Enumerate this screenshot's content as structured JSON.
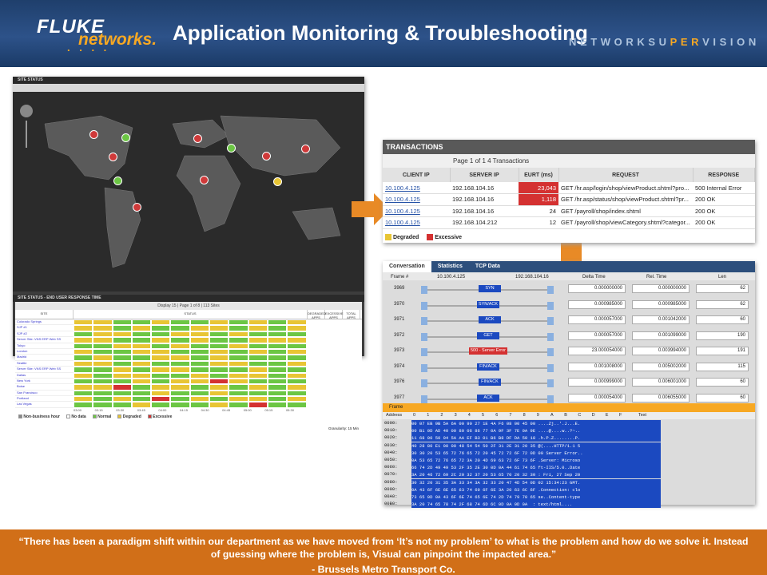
{
  "header": {
    "logo_main": "FLUKE",
    "logo_sub": "networks.",
    "title": "Application Monitoring & Troubleshooting",
    "tagline_left": "NETWORKSU",
    "tagline_mid": "PER",
    "tagline_right": "VISION"
  },
  "site_status": {
    "title": "SITE STATUS",
    "grid_title": "SITE STATUS - END USER RESPONSE TIME",
    "toolbar": "Display 15 | Page 1 of 8 | 113 Sites",
    "columns": [
      "SITE",
      "STATUS",
      "DEGRADED APPS",
      "EXCESSIVE APPS",
      "TOTAL APPS"
    ],
    "sites": [
      "Colorado Springs",
      "SJP #1",
      "SJP #2",
      "Server Site: VNS ERP Web SS",
      "Tokyo",
      "London",
      "Madrid",
      "Seattle",
      "Server Site: VNS ERP Web SS",
      "Dallas",
      "New York",
      "Boise",
      "San Francisco",
      "Portland",
      "Las Vegas"
    ],
    "time_labels": [
      "03:00",
      "03:15",
      "03:30",
      "03:45",
      "04:00",
      "04:15",
      "04:30",
      "04:45",
      "05:00",
      "05:15",
      "05:30"
    ],
    "legend": [
      "Non-business hour",
      "No data",
      "Normal",
      "Degraded",
      "Excessive"
    ],
    "granularity": "Granularity: 15 Min"
  },
  "transactions": {
    "title": "TRANSACTIONS",
    "pager": "Page 1 of 1     4 Transactions",
    "columns": [
      "CLIENT IP",
      "SERVER IP",
      "EURT (ms)",
      "REQUEST",
      "RESPONSE"
    ],
    "rows": [
      {
        "client": "10.100.4.125",
        "server": "192.168.104.16",
        "eurt": "23,043",
        "request": "GET /hr.asp/login/shop/viewProduct.shtml?pro...",
        "response": "500 Internal Error"
      },
      {
        "client": "10.100.4.125",
        "server": "192.168.104.16",
        "eurt": "1,118",
        "request": "GET /hr.asp/status/shop/viewProduct.shtml?pr...",
        "response": "200 OK"
      },
      {
        "client": "10.100.4.125",
        "server": "192.168.104.16",
        "eurt": "24",
        "request": "GET /payroll/shop/index.shtml",
        "response": "200 OK"
      },
      {
        "client": "10.100.4.125",
        "server": "192.168.104.212",
        "eurt": "12",
        "request": "GET /payroll/shop/viewCategory.shtml?categor...",
        "response": "200 OK"
      }
    ],
    "legend": [
      "Degraded",
      "Excessive"
    ]
  },
  "conversation": {
    "tabs": [
      "Conversation",
      "Statistics",
      "TCP Data"
    ],
    "columns": [
      "Frame #",
      "10.100.4.125",
      "192.168.104.16",
      "Delta Time",
      "Rel. Time",
      "Len"
    ],
    "frames": [
      {
        "frame": "3969",
        "label": "SYN",
        "delta": "0.000000000",
        "rel": "0.000000000",
        "len": "62"
      },
      {
        "frame": "3970",
        "label": "SYN/ACK",
        "delta": "0.000985000",
        "rel": "0.000985000",
        "len": "62"
      },
      {
        "frame": "3971",
        "label": "ACK",
        "delta": "0.000057000",
        "rel": "0.001042000",
        "len": "60"
      },
      {
        "frame": "3972",
        "label": "GET",
        "delta": "0.000057000",
        "rel": "0.001099000",
        "len": "190"
      },
      {
        "frame": "3973",
        "label": "500 - Server Error",
        "delta": "23.000054000",
        "rel": "0.003994000",
        "len": "191"
      },
      {
        "frame": "3974",
        "label": "FIN/ACK",
        "delta": "0.001008000",
        "rel": "0.005002000",
        "len": "115"
      },
      {
        "frame": "3976",
        "label": "FIN/ACK",
        "delta": "0.000999000",
        "rel": "0.006001000",
        "len": "60"
      },
      {
        "frame": "3977",
        "label": "ACK",
        "delta": "0.000054000",
        "rel": "0.006055000",
        "len": "60"
      }
    ],
    "frame_tab": "Frame",
    "hex_header": [
      "Address",
      "0",
      "1",
      "2",
      "3",
      "4",
      "5",
      "6",
      "7",
      "8",
      "9",
      "A",
      "B",
      "C",
      "D",
      "E",
      "F",
      "Text"
    ],
    "hex_rows": [
      [
        "0000:",
        "00 07 EB 9B 5A 6A 00 90 27 1E 4A F6 08 00 45 00 ....Zj..'.J...E."
      ],
      [
        "0010:",
        "00 B1 0D AD 40 00 80 06 86 77 0A 9F 3F 7E 0A 9E ....@....w..?~.."
      ],
      [
        "0020:",
        "11 68 00 50 04 5A AA EF B3 01 B6 B8 DF DA 50 18 .h.P.Z........P."
      ],
      [
        "0030:",
        "40 28 80 E1 00 00 48 54 54 50 2F 31 2E 31 20 35 @(....HTTP/1.1 5"
      ],
      [
        "0040:",
        "30 30 20 53 65 72 76 65 72 20 45 72 72 6F 72 0D 00 Server Error.."
      ],
      [
        "0050:",
        "0A 53 65 72 76 65 72 3A 20 4D 69 63 72 6F 73 6F .Server: Microso"
      ],
      [
        "0060:",
        "66 74 2D 49 49 53 2F 35 2E 30 0D 0A 44 61 74 65 ft-IIS/5.0..Date"
      ],
      [
        "0070:",
        "3A 20 46 72 69 2C 20 32 37 20 53 65 70 20 32 30 : Fri, 27 Sep 20"
      ],
      [
        "0080:",
        "30 32 20 31 35 3A 33 34 3A 32 33 20 47 4D 54 0D 02 15:34:23 GMT."
      ],
      [
        "0090:",
        "0A 43 6F 6E 6E 65 63 74 69 6F 6E 3A 20 63 6C 6F .Connection: clo"
      ],
      [
        "00A0:",
        "73 65 0D 0A 43 6F 6E 74 65 6E 74 2D 74 79 70 65 se..Content-type"
      ],
      [
        "00B0:",
        "3A 20 74 65 78 74 2F 68 74 6D 6C 0D 0A 0D 0A  : text/html...."
      ]
    ]
  },
  "quote": {
    "text": "“There has been a paradigm shift within our department as we have moved from ‘It’s not my problem’ to what is the problem and how do we solve it.  Instead of guessing where the problem is, Visual can pinpoint the impacted area.”",
    "author": "- Brussels Metro Transport Co."
  },
  "colors": {
    "normal": "#6cc644",
    "degraded": "#e8c534",
    "excessive": "#d43131",
    "nodata": "#ffffff",
    "orange": "#e88a26"
  }
}
